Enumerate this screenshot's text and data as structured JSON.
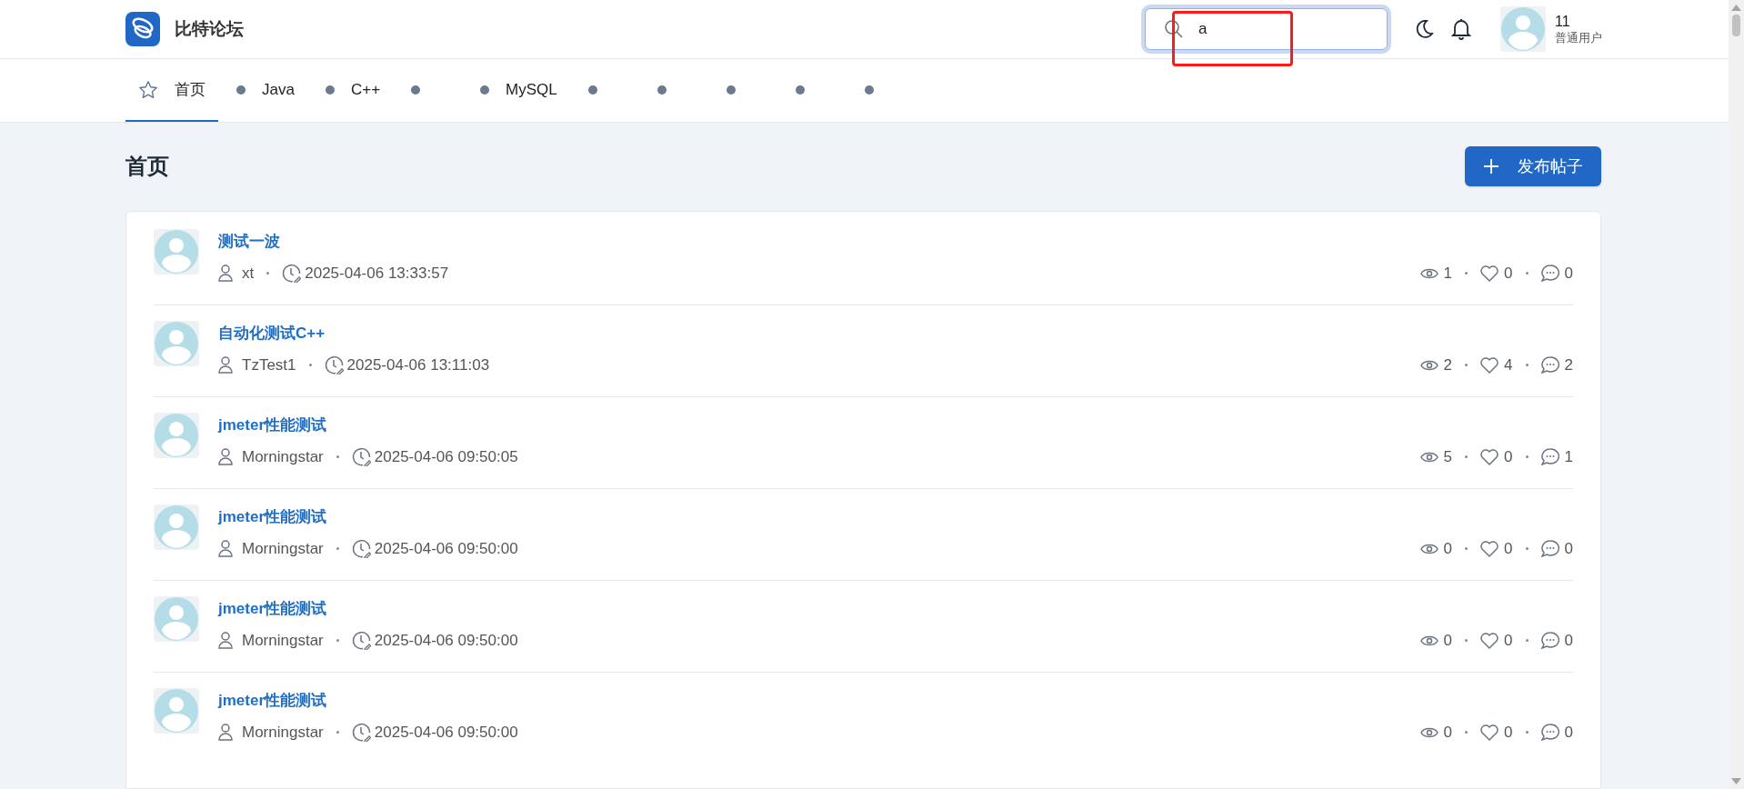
{
  "header": {
    "site_name": "比特论坛",
    "search": {
      "value": "a",
      "focused": true
    },
    "highlight": true,
    "user": {
      "name": "11",
      "role": "普通用户"
    }
  },
  "nav": [
    {
      "label": "首页",
      "kind": "home",
      "selected": true
    },
    {
      "label": "Java",
      "kind": "board",
      "selected": false
    },
    {
      "label": "C++",
      "kind": "board",
      "selected": false
    },
    {
      "kind": "board",
      "selected": false
    },
    {
      "label": "MySQL",
      "kind": "board",
      "selected": false
    },
    {
      "kind": "board",
      "selected": false
    },
    {
      "kind": "board",
      "selected": false
    },
    {
      "kind": "board",
      "selected": false
    },
    {
      "kind": "board",
      "selected": false
    },
    {
      "kind": "board",
      "selected": false
    }
  ],
  "page_title": "首页",
  "new_post_button": "发布帖子",
  "posts": [
    {
      "title": "测试一波",
      "author": "xt",
      "time": "2025-04-06 13:33:57",
      "views": "1",
      "likes": "0",
      "comments": "0"
    },
    {
      "title": "自动化测试C++",
      "author": "TzTest1",
      "time": "2025-04-06 13:11:03",
      "views": "2",
      "likes": "4",
      "comments": "2"
    },
    {
      "title": "jmeter性能测试",
      "author": "Morningstar",
      "time": "2025-04-06 09:50:05",
      "views": "5",
      "likes": "0",
      "comments": "1"
    },
    {
      "title": "jmeter性能测试",
      "author": "Morningstar",
      "time": "2025-04-06 09:50:00",
      "views": "0",
      "likes": "0",
      "comments": "0"
    },
    {
      "title": "jmeter性能测试",
      "author": "Morningstar",
      "time": "2025-04-06 09:50:00",
      "views": "0",
      "likes": "0",
      "comments": "0"
    },
    {
      "title": "jmeter性能测试",
      "author": "Morningstar",
      "time": "2025-04-06 09:50:00",
      "views": "0",
      "likes": "0",
      "comments": "0"
    }
  ]
}
